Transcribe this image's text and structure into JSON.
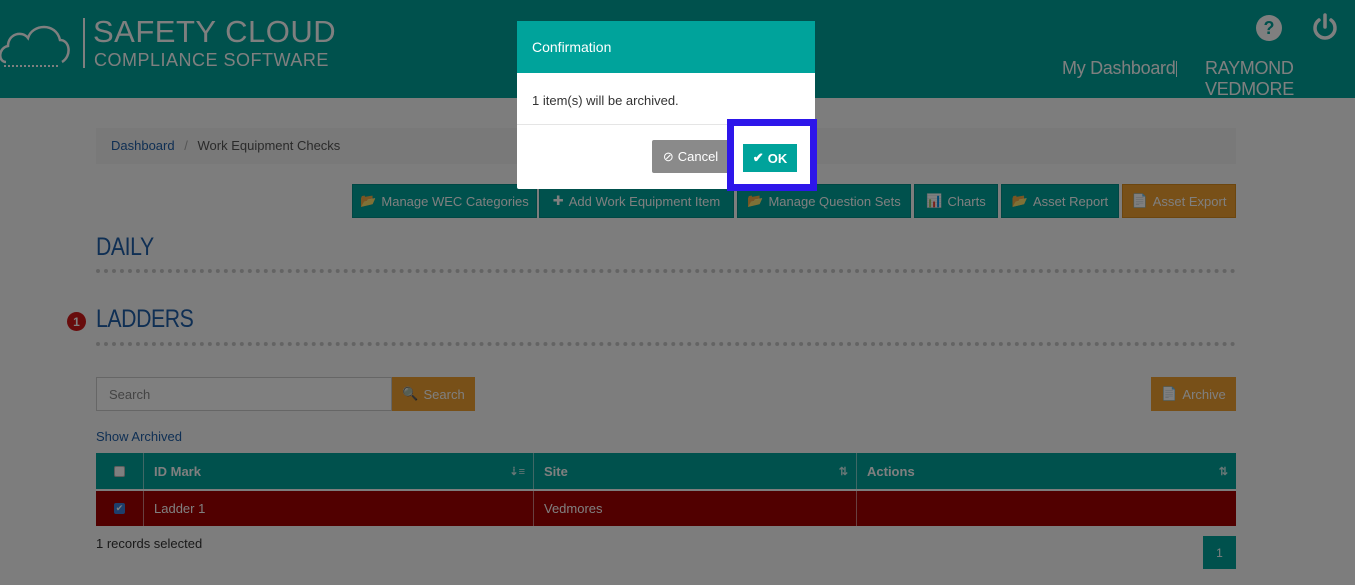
{
  "header": {
    "logo_line1": "SAFETY CLOUD",
    "logo_line2": "COMPLIANCE SOFTWARE",
    "help_glyph": "?",
    "power_glyph": "⏻",
    "nav_dashboard": "My Dashboard",
    "nav_user": "RAYMOND VEDMORE"
  },
  "breadcrumb": {
    "home": "Dashboard",
    "separator": "/",
    "current": "Work Equipment Checks"
  },
  "toolbar": {
    "buttons": [
      {
        "label": "Manage WEC Categories",
        "icon": "📂"
      },
      {
        "label": "Add Work Equipment Item",
        "icon": "✚"
      },
      {
        "label": "Manage Question Sets",
        "icon": "📂"
      },
      {
        "label": "Charts",
        "icon": "📊"
      },
      {
        "label": "Asset Report",
        "icon": "📂"
      },
      {
        "label": "Asset Export",
        "icon": "📄"
      }
    ]
  },
  "sections": {
    "daily": "DAILY",
    "ladders": "LADDERS",
    "ladders_badge": "1"
  },
  "search": {
    "placeholder": "Search",
    "button_label": "Search",
    "button_icon": "🔍",
    "archive_label": "Archive",
    "archive_icon": "📄",
    "show_archived": "Show Archived"
  },
  "table": {
    "columns": [
      "ID Mark",
      "Site",
      "Actions"
    ],
    "rows": [
      {
        "id_mark": "Ladder 1",
        "site": "Vedmores",
        "actions": "",
        "checked": true
      }
    ],
    "records_selected": "1 records selected",
    "page": "1"
  },
  "modal": {
    "title": "Confirmation",
    "message": "1 item(s) will be archived.",
    "cancel_label": "Cancel",
    "cancel_icon": "⊘",
    "ok_label": "OK",
    "ok_icon": "✔"
  },
  "colors": {
    "teal": "#00a39b",
    "orange": "#f0a030",
    "selected_row": "#a30000",
    "highlight": "#2d16ea"
  }
}
